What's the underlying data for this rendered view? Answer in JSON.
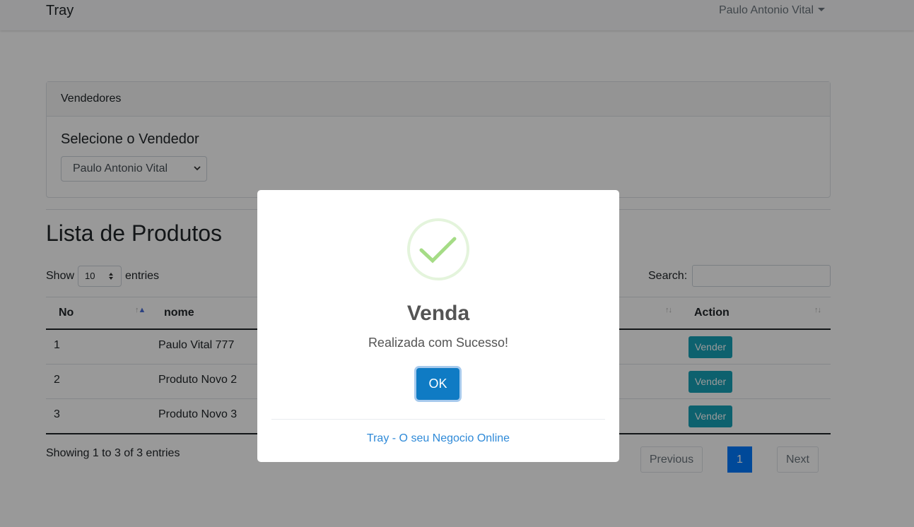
{
  "navbar": {
    "brand": "Tray",
    "user": "Paulo Antonio Vital"
  },
  "vendedores": {
    "header": "Vendedores",
    "title": "Selecione o Vendedor",
    "selected": "Paulo Antonio Vital"
  },
  "products": {
    "title": "Lista de Produtos",
    "show_label": "Show",
    "entries_label": "entries",
    "page_length": "10",
    "search_label": "Search:",
    "columns": [
      "No",
      "nome",
      "Action"
    ],
    "rows": [
      {
        "no": "1",
        "nome": "Paulo Vital 777",
        "action": "Vender"
      },
      {
        "no": "2",
        "nome": "Produto Novo 2",
        "action": "Vender"
      },
      {
        "no": "3",
        "nome": "Produto Novo 3",
        "action": "Vender"
      }
    ],
    "info": "Showing 1 to 3 of 3 entries",
    "pagination": {
      "previous": "Previous",
      "current": "1",
      "next": "Next"
    }
  },
  "modal": {
    "title": "Venda",
    "text": "Realizada com Sucesso!",
    "ok": "OK",
    "footer": "Tray - O seu Negocio Online"
  },
  "colors": {
    "primary": "#007bff",
    "info_button": "#17a2b8",
    "ok_button": "#0f7bc4",
    "success_icon": "#a5dc86"
  },
  "icons": [
    "chevron-down-icon",
    "sort-icon",
    "success-check-icon"
  ]
}
